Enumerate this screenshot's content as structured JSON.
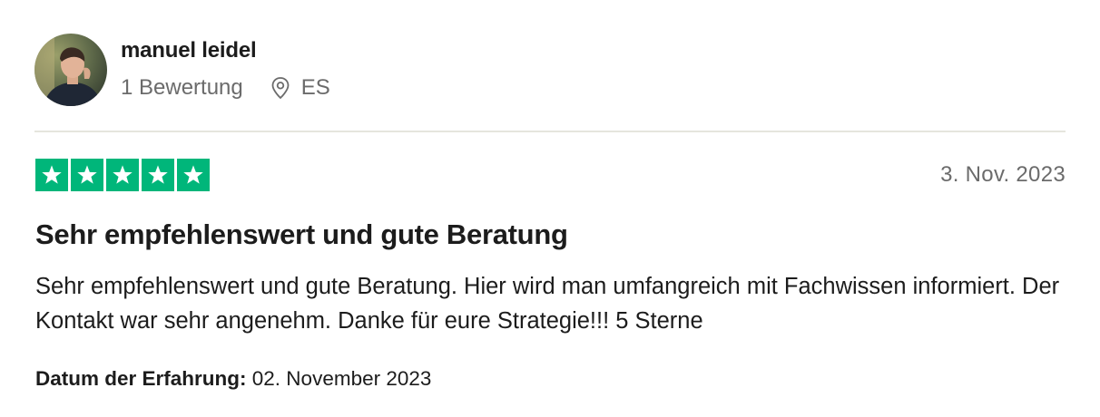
{
  "reviewer": {
    "name": "manuel leidel",
    "review_count": "1 Bewertung",
    "country": "ES"
  },
  "review": {
    "rating": 5,
    "max_rating": 5,
    "date": "3. Nov. 2023",
    "title": "Sehr empfehlenswert und gute Beratung",
    "body": "Sehr empfehlenswert und gute Beratung. Hier wird man umfangreich mit Fachwissen informiert. Der Kontakt war sehr angenehm. Danke für eure Strategie!!! 5 Sterne",
    "experience_label": "Datum der Erfahrung:",
    "experience_date": "02. November 2023"
  },
  "icons": {
    "avatar": "avatar-photo",
    "location": "location-pin-icon",
    "star": "star-icon"
  },
  "colors": {
    "star_fill": "#00b67a",
    "text_primary": "#1c1c1c",
    "text_secondary": "#6b6b6b",
    "divider": "#e5e5dd"
  }
}
